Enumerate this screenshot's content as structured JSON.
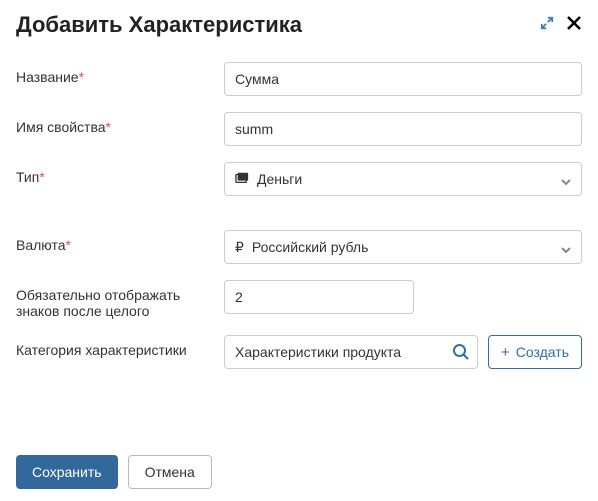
{
  "dialog": {
    "title": "Добавить Характеристика"
  },
  "fields": {
    "name": {
      "label": "Название",
      "value": "Сумма"
    },
    "property": {
      "label": "Имя свойства",
      "value": "summ"
    },
    "type": {
      "label": "Тип",
      "value": "Деньги"
    },
    "currency": {
      "label": "Валюта",
      "symbol": "₽",
      "value": "Российский рубль"
    },
    "decimals": {
      "label": "Обязательно отображать знаков после целого",
      "value": "2"
    },
    "category": {
      "label": "Категория характеристики",
      "value": "Характеристики продукта"
    }
  },
  "buttons": {
    "create": "Создать",
    "save": "Сохранить",
    "cancel": "Отмена"
  }
}
